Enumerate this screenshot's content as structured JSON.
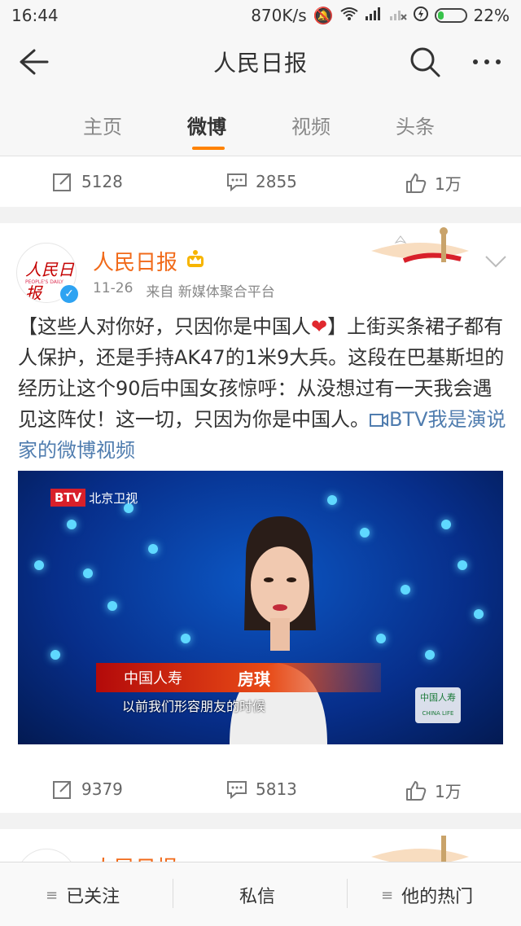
{
  "status_bar": {
    "time": "16:44",
    "speed": "870K/s",
    "battery_percent": "22%",
    "battery_level": 0.22
  },
  "header": {
    "title": "人民日报"
  },
  "tabs": [
    {
      "label": "主页"
    },
    {
      "label": "微博"
    },
    {
      "label": "视频"
    },
    {
      "label": "头条"
    }
  ],
  "card1": {
    "reposts": "5128",
    "comments": "2855",
    "likes": "1万"
  },
  "post": {
    "author": "人民日报",
    "date": "11-26",
    "source": "来自 新媒体聚合平台",
    "text_before_heart": "【这些人对你好，只因你是中国人",
    "heart": "❤",
    "text_after_heart": "】上街买条裙子都有人保护，还是手持AK47的1米9大兵。这段在巴基斯坦的经历让这个90后中国女孩惊呼：从没想过有一天我会遇见这阵仗！这一切，只因为你是中国人。",
    "video_link": "BTV我是演说家的微博视频",
    "video": {
      "channel_badge": "BTV",
      "channel_name": "北京卫视",
      "sponsor": "中国人寿",
      "sponsor_en": "CHINA LIFE",
      "speaker": "房琪",
      "subtitle": "以前我们形容朋友的时候",
      "corner_logo": "中国人寿"
    },
    "reposts": "9379",
    "comments": "5813",
    "likes": "1万"
  },
  "card3": {
    "author": "人民日报"
  },
  "bottom_bar": {
    "following": "已关注",
    "message": "私信",
    "hot": "他的热门"
  },
  "colors": {
    "accent": "#ff8200",
    "author_name": "#f16a1a",
    "link": "#507daf",
    "verified": "#2ea3f2"
  }
}
